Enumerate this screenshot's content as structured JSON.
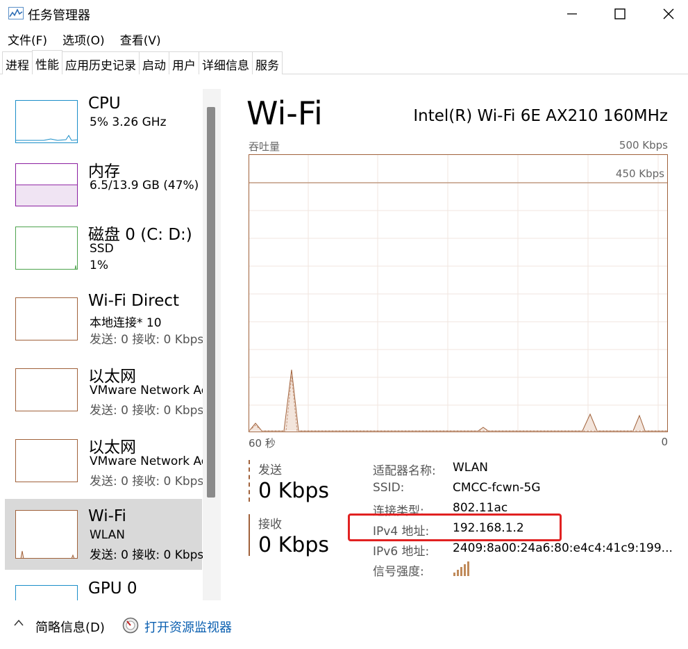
{
  "window": {
    "title": "任务管理器"
  },
  "menu": [
    "文件(F)",
    "选项(O)",
    "查看(V)"
  ],
  "tabs": [
    "进程",
    "性能",
    "应用历史记录",
    "启动",
    "用户",
    "详细信息",
    "服务"
  ],
  "active_tab": "性能",
  "devices": [
    {
      "title": "CPU",
      "line1": "5%  3.26 GHz",
      "line2": "",
      "color": "#1a8ec8"
    },
    {
      "title": "内存",
      "line1": "6.5/13.9 GB (47%)",
      "line2": "",
      "color": "#8b1ea0"
    },
    {
      "title": "磁盘 0 (C: D:)",
      "line1": "SSD",
      "line2": "1%",
      "color": "#4da34d"
    },
    {
      "title": "Wi-Fi Direct",
      "line1": "本地连接* 10",
      "line2": "发送: 0  接收: 0 Kbps",
      "color": "#a0613a"
    },
    {
      "title": "以太网",
      "line1": "VMware Network Adapter",
      "line2": "发送: 0  接收: 0 Kbps",
      "color": "#a0613a"
    },
    {
      "title": "以太网",
      "line1": "VMware Network Adapter",
      "line2": "发送: 0  接收: 0 Kbps",
      "color": "#a0613a"
    },
    {
      "title": "Wi-Fi",
      "line1": "WLAN",
      "line2": "发送: 0  接收: 0 Kbps",
      "color": "#a0613a"
    },
    {
      "title": "GPU 0",
      "line1": "",
      "line2": "",
      "color": "#1a8ec8"
    }
  ],
  "selected_device": "Wi-Fi",
  "main": {
    "title": "Wi-Fi",
    "adapter": "Intel(R) Wi-Fi 6E AX210 160MHz",
    "graph_label": "吞吐量",
    "graph_max": "500 Kbps",
    "graph_line_label": "450 Kbps",
    "graph_time": "60 秒",
    "graph_zero": "0",
    "send_label": "发送",
    "send_value": "0 Kbps",
    "recv_label": "接收",
    "recv_value": "0 Kbps",
    "props": [
      {
        "key": "适配器名称:",
        "value": "WLAN"
      },
      {
        "key": "SSID:",
        "value": "CMCC-fcwn-5G"
      },
      {
        "key": "连接类型:",
        "value": "802.11ac"
      },
      {
        "key": "IPv4 地址:",
        "value": "192.168.1.2"
      },
      {
        "key": "IPv6 地址:",
        "value": "2409:8a00:24a6:80:e4c4:41c9:199..."
      },
      {
        "key": "信号强度:",
        "value": ""
      }
    ]
  },
  "footer": {
    "less_details": "简略信息(D)",
    "open_resmon": "打开资源监视器"
  },
  "colors": {
    "network": "#a0613a",
    "highlight": "#e12121",
    "link": "#0a5fb0"
  }
}
